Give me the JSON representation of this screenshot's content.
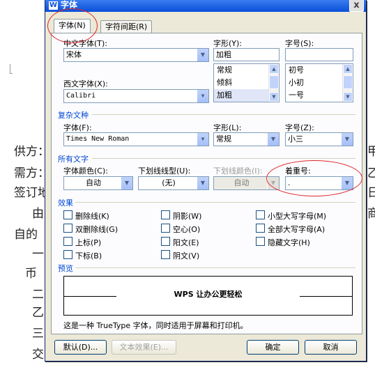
{
  "background_doc": {
    "lines_left": [
      "供方：",
      "需方：",
      "签订地",
      "由",
      "自的",
      "一",
      "币",
      "二",
      "乙",
      "三",
      "交"
    ],
    "lines_right": [
      "甲",
      "乙",
      "日",
      "商"
    ]
  },
  "dialog": {
    "title": "字体",
    "icon_label": "W",
    "close_label": "x",
    "tabs": [
      {
        "label": "字体(N)"
      },
      {
        "label": "字符间距(R)"
      }
    ],
    "chinese_font": {
      "label": "中文字体(T):",
      "value": "宋体"
    },
    "style": {
      "label": "字形(Y):",
      "value": "加粗",
      "items": [
        "常规",
        "倾斜",
        "加粗"
      ]
    },
    "size": {
      "label": "字号(S):",
      "value": "",
      "items": [
        "初号",
        "小初",
        "一号"
      ]
    },
    "western_font": {
      "label": "西文字体(X):",
      "value": "Calibri"
    },
    "complex": {
      "section_label": "复杂文种",
      "font_label": "字体(F):",
      "font_value": "Times New Roman",
      "style_label": "字形(L):",
      "style_value": "常规",
      "size_label": "字号(Z):",
      "size_value": "小三"
    },
    "all_text": {
      "section_label": "所有文字",
      "color_label": "字体颜色(C):",
      "color_value": "自动",
      "underline_label": "下划线线型(U):",
      "underline_value": "(无)",
      "underline_color_label": "下划线颜色(I):",
      "underline_color_value": "自动",
      "emphasis_label": "着重号:",
      "emphasis_value": "."
    },
    "effects": {
      "section_label": "效果",
      "items": [
        {
          "label": "删除线(K)"
        },
        {
          "label": "双删除线(G)"
        },
        {
          "label": "上标(P)"
        },
        {
          "label": "下标(B)"
        },
        {
          "label": "阴影(W)"
        },
        {
          "label": "空心(O)"
        },
        {
          "label": "阳文(E)"
        },
        {
          "label": "阴文(V)"
        },
        {
          "label": "小型大写字母(M)"
        },
        {
          "label": "全部大写字母(A)"
        },
        {
          "label": "隐藏文字(H)"
        }
      ]
    },
    "preview": {
      "section_label": "预览",
      "sample_text": "WPS 让办公更轻松",
      "description": "这是一种 TrueType 字体，同时适用于屏幕和打印机。"
    },
    "buttons": {
      "default": "默认(D)...",
      "text_effects": "文本效果(E)...",
      "ok": "确定",
      "cancel": "取消"
    }
  },
  "colors": {
    "annotation": "#e0262b",
    "section_title": "#0046d5"
  }
}
